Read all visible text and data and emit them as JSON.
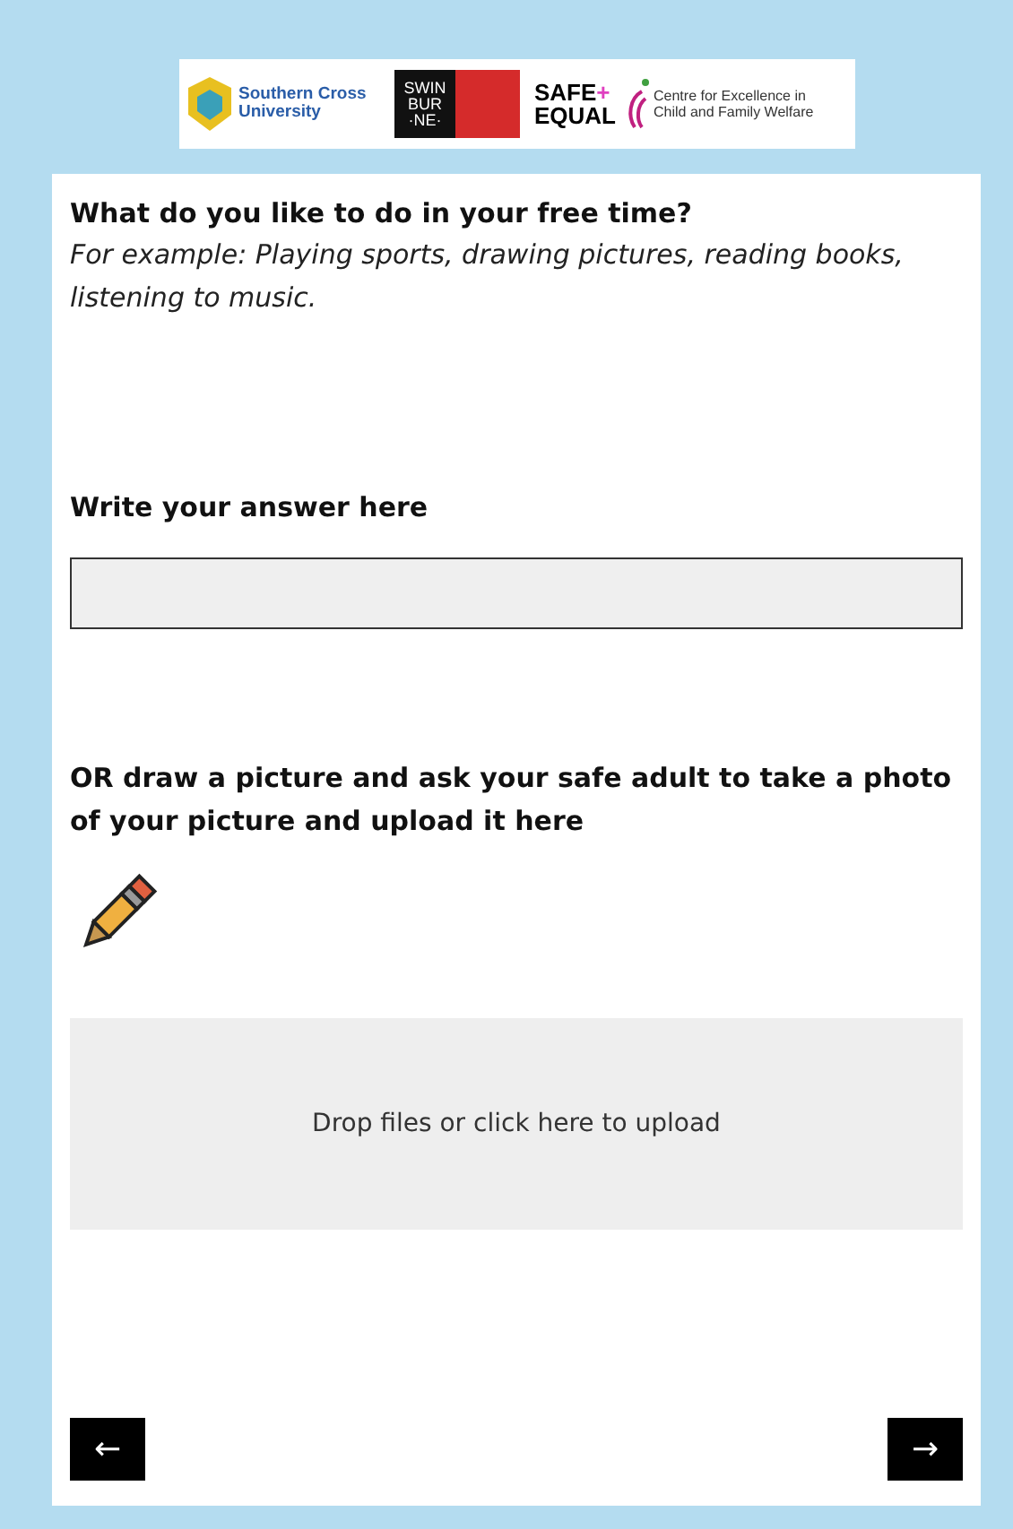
{
  "logos": {
    "scu": "Southern Cross University",
    "swinburne": [
      "SWIN",
      "BUR",
      "·NE·"
    ],
    "safe_equal": [
      "SAFE",
      "+",
      "EQUAL"
    ],
    "centre": [
      "Centre for Excellence in",
      "Child and Family Welfare"
    ]
  },
  "question": {
    "title": "What do you like to do in your free time?",
    "example": "For example: Playing sports, drawing pictures, reading books, listening to music."
  },
  "answer": {
    "label": "Write your answer here"
  },
  "upload": {
    "label": "OR draw a picture and ask your safe adult to take a photo of your picture and upload it here",
    "dropzone": "Drop files or click here to upload"
  },
  "nav": {
    "back": "←",
    "next": "→"
  }
}
